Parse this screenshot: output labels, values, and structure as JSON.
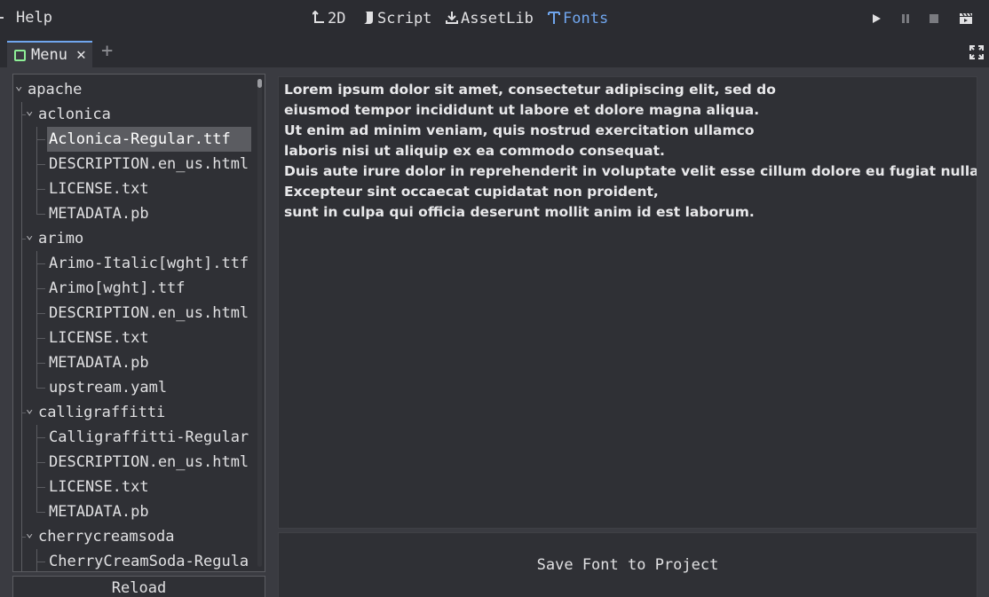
{
  "menubar": {
    "help_label": "Help"
  },
  "workspaces": [
    {
      "label": "2D",
      "icon": "2d-axis-icon"
    },
    {
      "label": "Script",
      "icon": "script-icon"
    },
    {
      "label": "AssetLib",
      "icon": "download-icon"
    },
    {
      "label": "Fonts",
      "icon": "font-icon"
    }
  ],
  "active_workspace": "Fonts",
  "accent_color": "#70a6ee",
  "tab": {
    "label": "Menu"
  },
  "tree": {
    "items": [
      {
        "label": "apache",
        "depth": 0,
        "expanded": true
      },
      {
        "label": "aclonica",
        "depth": 1,
        "expanded": true
      },
      {
        "label": "Aclonica-Regular.ttf",
        "depth": 2,
        "selected": true
      },
      {
        "label": "DESCRIPTION.en_us.html",
        "depth": 2
      },
      {
        "label": "LICENSE.txt",
        "depth": 2
      },
      {
        "label": "METADATA.pb",
        "depth": 2
      },
      {
        "label": "arimo",
        "depth": 1,
        "expanded": true
      },
      {
        "label": "Arimo-Italic[wght].ttf",
        "depth": 2
      },
      {
        "label": "Arimo[wght].ttf",
        "depth": 2
      },
      {
        "label": "DESCRIPTION.en_us.html",
        "depth": 2
      },
      {
        "label": "LICENSE.txt",
        "depth": 2
      },
      {
        "label": "METADATA.pb",
        "depth": 2
      },
      {
        "label": "upstream.yaml",
        "depth": 2
      },
      {
        "label": "calligraffitti",
        "depth": 1,
        "expanded": true
      },
      {
        "label": "Calligraffitti-Regular",
        "depth": 2
      },
      {
        "label": "DESCRIPTION.en_us.html",
        "depth": 2
      },
      {
        "label": "LICENSE.txt",
        "depth": 2
      },
      {
        "label": "METADATA.pb",
        "depth": 2
      },
      {
        "label": "cherrycreamsoda",
        "depth": 1,
        "expanded": true
      },
      {
        "label": "CherryCreamSoda-Regula",
        "depth": 2
      }
    ]
  },
  "reload_label": "Reload",
  "preview": {
    "lines": [
      "Lorem ipsum dolor sit amet, consectetur adipiscing elit, sed do",
      "eiusmod tempor incididunt ut labore et dolore magna aliqua.",
      "Ut enim ad minim veniam, quis nostrud exercitation ullamco",
      "laboris nisi ut aliquip ex ea commodo consequat.",
      "Duis aute irure dolor in reprehenderit in voluptate velit esse cillum dolore eu fugiat nulla",
      "Excepteur sint occaecat cupidatat non proident,",
      "sunt in culpa qui officia deserunt mollit anim id est laborum."
    ]
  },
  "save_label": "Save Font to Project"
}
